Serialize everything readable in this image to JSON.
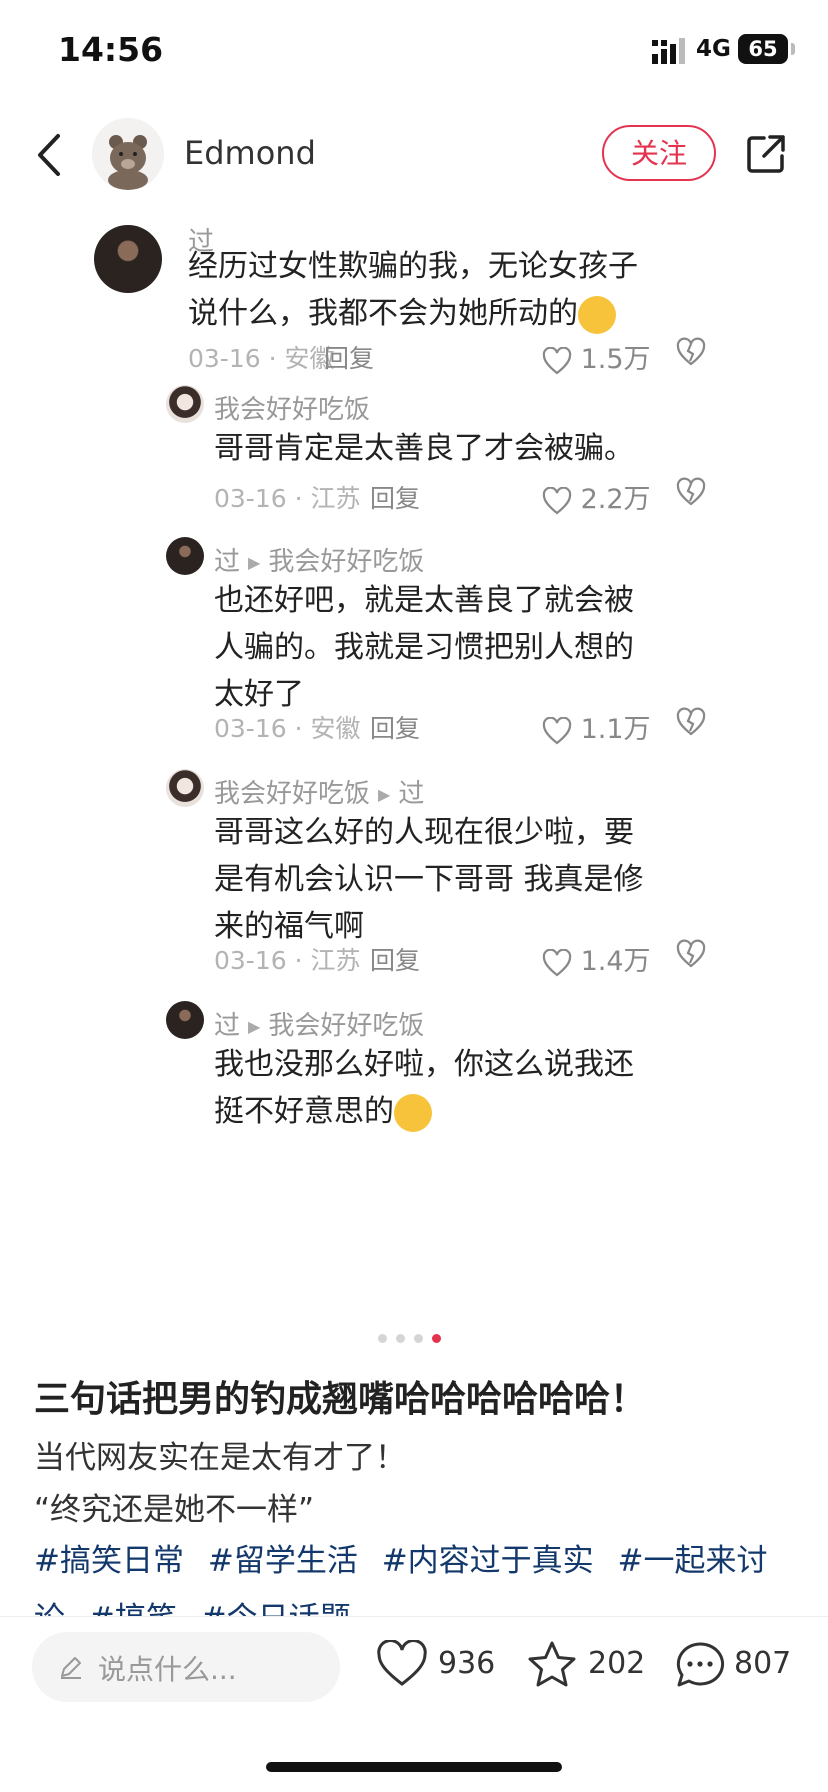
{
  "status_bar": {
    "time": "14:56",
    "network": "4G",
    "battery": "65"
  },
  "header": {
    "author": "Edmond",
    "follow_label": "关注"
  },
  "comments": [
    {
      "user": "过",
      "text": "经历过女性欺骗的我，无论女孩子说什么，我都不会为她所动的",
      "meta": "03-16 · 安徽",
      "reply": "回复",
      "likes": "1.5万"
    },
    {
      "user": "我会好好吃饭",
      "text": "哥哥肯定是太善良了才会被骗。",
      "meta": "03-16 · 江苏",
      "reply": "回复",
      "likes": "2.2万"
    },
    {
      "user": "过",
      "reply_to": "我会好好吃饭",
      "text": "也还好吧，就是太善良了就会被人骗的。我就是习惯把别人想的太好了",
      "meta": "03-16 · 安徽",
      "reply": "回复",
      "likes": "1.1万"
    },
    {
      "user": "我会好好吃饭",
      "reply_to": "过",
      "text": "哥哥这么好的人现在很少啦，要是有机会认识一下哥哥 我真是修来的福气啊",
      "meta": "03-16 · 江苏",
      "reply": "回复",
      "likes": "1.4万"
    },
    {
      "user": "过",
      "reply_to": "我会好好吃饭",
      "text": "我也没那么好啦，你这么说我还挺不好意思的"
    }
  ],
  "post": {
    "title": "三句话把男的钓成翘嘴哈哈哈哈哈哈！",
    "desc_line1": "当代网友实在是太有才了！",
    "desc_line2": "“终究还是她不一样”",
    "tags": [
      "#搞笑日常",
      "#留学生活",
      "#内容过于真实",
      "#一起来讨论",
      "#搞笑",
      "#今日话题"
    ]
  },
  "bottom_bar": {
    "comment_placeholder": "说点什么...",
    "likes": "936",
    "collects": "202",
    "comments": "807"
  },
  "colors": {
    "accent": "#e4334f",
    "tag": "#13386c"
  }
}
